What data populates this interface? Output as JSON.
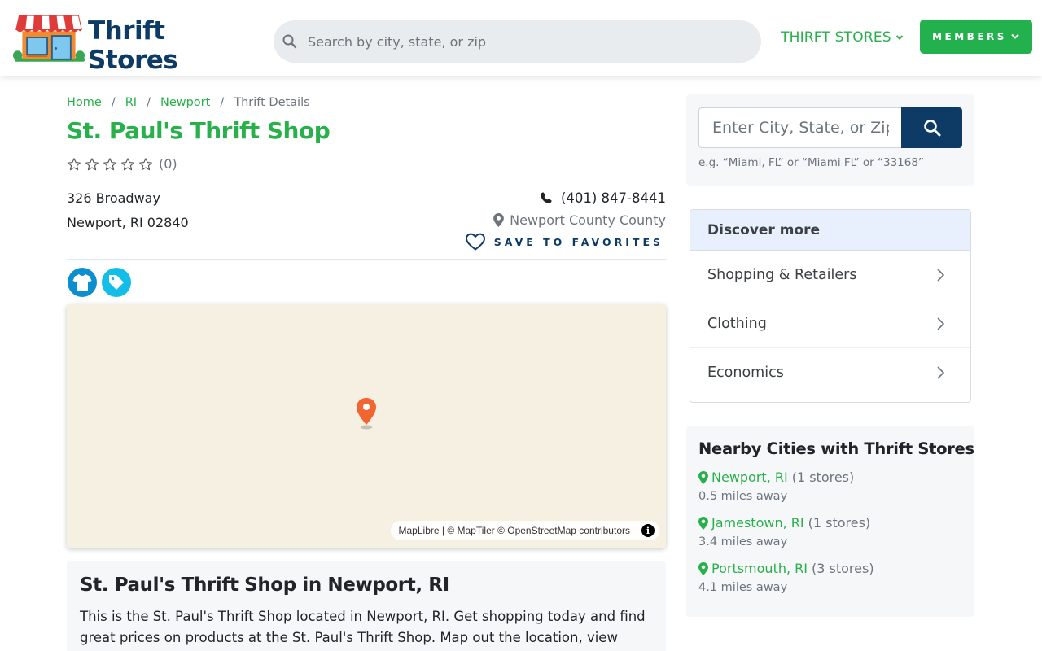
{
  "header": {
    "logo_text": "Thrift Stores",
    "search_placeholder": "Search by city, state, or zip",
    "nav_stores_label": "THIRFT STORES",
    "members_label": "MEMBERS"
  },
  "breadcrumb": [
    {
      "label": "Home"
    },
    {
      "label": "RI"
    },
    {
      "label": "Newport"
    },
    {
      "label": "Thrift Details"
    }
  ],
  "store": {
    "name": "St. Paul's Thrift Shop",
    "rating_count": "(0)",
    "rating_stars": 0,
    "address_line1": "326 Broadway",
    "address_line2": "Newport, RI 02840",
    "phone": "(401) 847-8441",
    "county": "Newport County County",
    "favorites_label": "SAVE TO FAVORITES"
  },
  "map": {
    "attribution": "MapLibre | © MapTiler © OpenStreetMap contributors",
    "info_label": "i"
  },
  "about": {
    "title": "St. Paul's Thrift Shop in Newport, RI",
    "text": "This is the St. Paul's Thrift Shop located in Newport, RI. Get shopping today and find great prices on products at the St. Paul's Thrift Shop. Map out the location, view contact info,"
  },
  "sidebar": {
    "search_placeholder": "Enter City, State, or Zip",
    "search_hint": "e.g. “Miami, FL” or “Miami FL” or “33168”",
    "discover_title": "Discover more",
    "discover_items": [
      {
        "label": "Shopping & Retailers"
      },
      {
        "label": "Clothing"
      },
      {
        "label": "Economics"
      }
    ],
    "nearby_title": "Nearby Cities with Thrift Stores",
    "nearby": [
      {
        "city": "Newport, RI",
        "count": "(1 stores)",
        "distance": "0.5 miles away"
      },
      {
        "city": "Jamestown, RI",
        "count": "(1 stores)",
        "distance": "3.4 miles away"
      },
      {
        "city": "Portsmouth, RI",
        "count": "(3 stores)",
        "distance": "4.1 miles away"
      }
    ]
  },
  "colors": {
    "brand_green": "#28b04a",
    "brand_navy": "#0d3b66",
    "map_pin": "#f26430"
  }
}
